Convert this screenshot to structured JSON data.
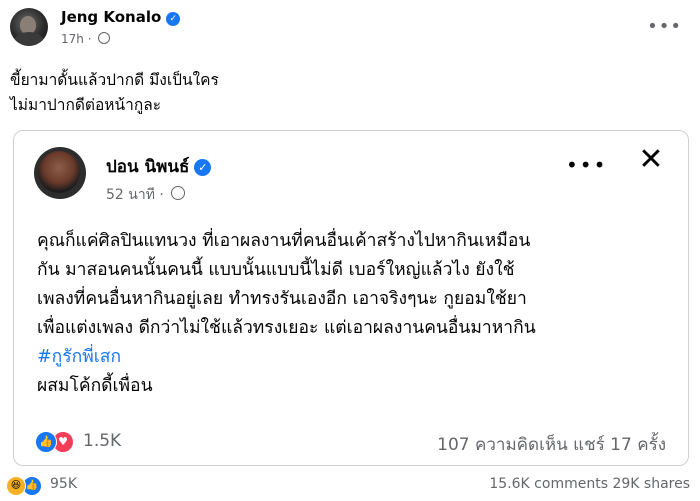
{
  "outer_post": {
    "author": "Jeng Konalo",
    "time": "17h",
    "text_lines": [
      "ขี้ยามาดั้นแล้วปากดี   มึงเป็นใคร",
      "ไม่มาปากดีต่อหน้ากูละ"
    ],
    "reactions_count": "95K",
    "comments": "15.6K comments",
    "shares": "29K shares"
  },
  "shared_post": {
    "author": "ปอน นิพนธ์",
    "time": "52 นาที",
    "text_lines": [
      "คุณก็แค่ศิลปินแทนวง ที่เอาผลงานที่คนอื่นเค้าสร้างไปหากินเหมือน",
      "กัน มาสอนคนนั้นคนนี้ แบบนั้นแบบนี้ไม่ดี เบอร์ใหญ่แล้วไง ยังใช้",
      "เพลงที่คนอื่นหากินอยู่เลย ทำทรงรันเองอีก เอาจริงๆนะ กูยอมใช้ยา",
      "เพื่อแต่งเพลง ดีกว่าไม่ใช้แล้วทรงเยอะ แต่เอาผลงานคนอื่นมาหากิน"
    ],
    "hashtag": "#กูรักพี่เสก",
    "last_line": "ผสมโค้กดี้เพื่อน",
    "reactions_count": "1.5K",
    "comments": "107 ความคิดเห็น",
    "shares": "แชร์ 17 ครั้ง"
  },
  "icons": {
    "verified": "verified-badge-icon",
    "globe": "globe-icon",
    "more": "more-options-icon",
    "close": "close-icon",
    "like": "like-reaction-icon",
    "love": "love-reaction-icon",
    "haha": "haha-reaction-icon"
  },
  "colors": {
    "brand_blue": "#1877f2",
    "secondary_text": "#65676b",
    "love_red": "#f33e58",
    "haha_yellow": "#f7b125"
  }
}
